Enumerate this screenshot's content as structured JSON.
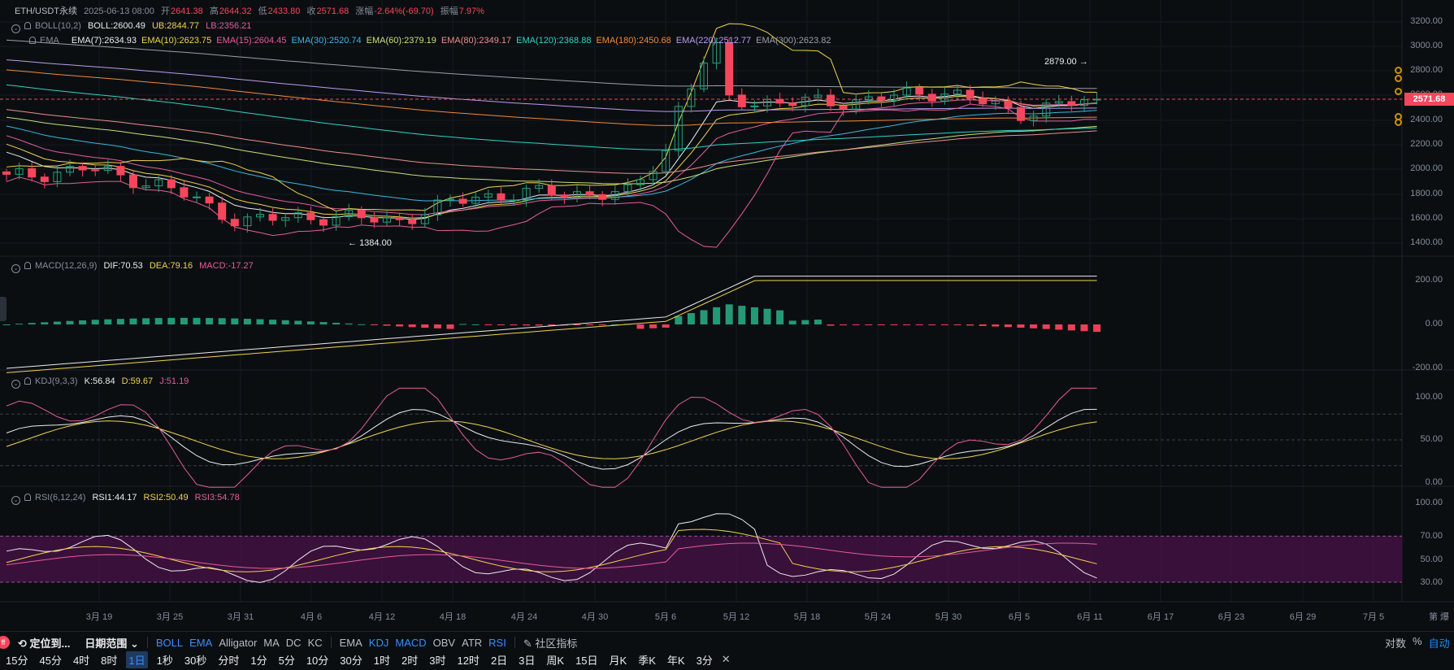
{
  "header": {
    "symbol": "ETH/USDT永续",
    "date": "2025-06-13 08:00",
    "open_label": "开",
    "open": "2641.38",
    "high_label": "高",
    "high": "2644.32",
    "low_label": "低",
    "low": "2433.80",
    "close_label": "收",
    "close": "2571.68",
    "change_label": "涨幅",
    "change": "-2.64%(-69.70)",
    "amp_label": "振幅",
    "amp": "7.97%"
  },
  "boll": {
    "label": "BOLL(10,2)",
    "mid": "BOLL:2600.49",
    "ub": "UB:2844.77",
    "lb": "LB:2356.21"
  },
  "ema": {
    "label": "EMA",
    "items": [
      {
        "text": "EMA(7):2634.93",
        "color": "#eaecef"
      },
      {
        "text": "EMA(10):2623.75",
        "color": "#f0d44c"
      },
      {
        "text": "EMA(15):2604.45",
        "color": "#e55c9c"
      },
      {
        "text": "EMA(30):2520.74",
        "color": "#3bb6e0"
      },
      {
        "text": "EMA(60):2379.19",
        "color": "#c5e07a"
      },
      {
        "text": "EMA(80):2349.17",
        "color": "#e88f8f"
      },
      {
        "text": "EMA(120):2368.88",
        "color": "#2ed3c6"
      },
      {
        "text": "EMA(180):2450.68",
        "color": "#f08a3a"
      },
      {
        "text": "EMA(220):2512.77",
        "color": "#b99cf0"
      },
      {
        "text": "EMA(300):2623.82",
        "color": "#9aa0a8"
      }
    ]
  },
  "macd": {
    "label": "MACD(12,26,9)",
    "dif": "DIF:70.53",
    "dea": "DEA:79.16",
    "macd": "MACD:-17.27"
  },
  "kdj": {
    "label": "KDJ(9,3,3)",
    "k": "K:56.84",
    "d": "D:59.67",
    "j": "J:51.19"
  },
  "rsi": {
    "label": "RSI(6,12,24)",
    "rsi1": "RSI1:44.17",
    "rsi2": "RSI2:50.49",
    "rsi3": "RSI3:54.78"
  },
  "price_axis": [
    "3200.00",
    "3000.00",
    "2800.00",
    "2600.00",
    "2400.00",
    "2200.00",
    "2000.00",
    "1800.00",
    "1600.00",
    "1400.00"
  ],
  "last_price": "2571.68",
  "annotations": {
    "high": "2879.00",
    "low": "1384.00"
  },
  "macd_axis": [
    "200.00",
    "0.00",
    "-200.00"
  ],
  "kdj_axis": [
    "100.00",
    "50.00",
    "0.00"
  ],
  "rsi_axis": [
    "100.00",
    "70.00",
    "50.00",
    "30.00"
  ],
  "date_axis": [
    "3月 19",
    "3月 25",
    "3月 31",
    "4月 6",
    "4月 12",
    "4月 18",
    "4月 24",
    "4月 30",
    "5月 6",
    "5月 12",
    "5月 18",
    "5月 24",
    "5月 30",
    "6月 5",
    "6月 11",
    "6月 17",
    "6月 23",
    "6月 29",
    "7月 5"
  ],
  "axis_corner": "第 爆",
  "toolbar": {
    "locate": "定位到...",
    "range": "日期范围",
    "main_indicators": [
      "BOLL",
      "EMA",
      "Alligator",
      "MA",
      "DC",
      "KC"
    ],
    "sub_indicators": [
      "EMA",
      "KDJ",
      "MACD",
      "OBV",
      "ATR",
      "RSI"
    ],
    "community": "社区指标",
    "right": [
      "对数",
      "%",
      "自动"
    ],
    "periods": [
      "15分",
      "45分",
      "4时",
      "8时",
      "1日",
      "1秒",
      "30秒",
      "分时",
      "1分",
      "5分",
      "10分",
      "30分",
      "1时",
      "2时",
      "3时",
      "12时",
      "2日",
      "3日",
      "周K",
      "15日",
      "月K",
      "季K",
      "年K",
      "3分"
    ],
    "selected_period": "1日"
  },
  "colors": {
    "up": "#26a17b",
    "down": "#f6465d",
    "bg": "#0b0e11",
    "grid": "#1b1f26",
    "accent": "#3a8dff"
  },
  "chart_data": {
    "type": "candlestick",
    "price_ylim": [
      1300,
      3260
    ],
    "dates": [
      "3月 19",
      "3月 25",
      "3月 31",
      "4月 6",
      "4月 12",
      "4月 18",
      "4月 24",
      "4月 30",
      "5月 6",
      "5月 12",
      "5月 18",
      "5月 24",
      "5月 30",
      "6月 5",
      "6月 11"
    ],
    "close_anchor": [
      1930,
      2010,
      1870,
      1580,
      1620,
      1580,
      1780,
      1810,
      1800,
      2580,
      2540,
      2560,
      2640,
      2460,
      2571.68
    ],
    "high": 2879.0,
    "low": 1384.0,
    "rsi_band": [
      30,
      70
    ],
    "kdj_levels": [
      20,
      50,
      80
    ]
  }
}
